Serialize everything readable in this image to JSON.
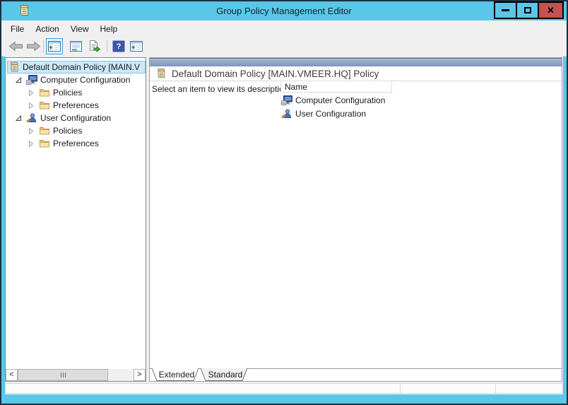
{
  "window": {
    "title": "Group Policy Management Editor",
    "app_icon": "gpo-scroll-icon",
    "controls": [
      "minimize",
      "maximize",
      "close"
    ],
    "close_glyph": "✕"
  },
  "menu_bar": {
    "items": [
      "File",
      "Action",
      "View",
      "Help"
    ]
  },
  "toolbar": {
    "buttons": [
      "back",
      "forward",
      "show-console-tree",
      "properties",
      "export-list",
      "help",
      "show-action-pane"
    ],
    "show_console_tree_active": true,
    "help_glyph": "?"
  },
  "tree": {
    "items": [
      {
        "label": "Default Domain Policy [MAIN.V",
        "icon": "gpo-scroll",
        "level": 0,
        "selected": true,
        "expander": "none"
      },
      {
        "label": "Computer Configuration",
        "icon": "computer",
        "level": 1,
        "selected": false,
        "expander": "expanded"
      },
      {
        "label": "Policies",
        "icon": "folder",
        "level": 2,
        "selected": false,
        "expander": "collapsed"
      },
      {
        "label": "Preferences",
        "icon": "folder",
        "level": 2,
        "selected": false,
        "expander": "collapsed"
      },
      {
        "label": "User Configuration",
        "icon": "user",
        "level": 1,
        "selected": false,
        "expander": "expanded"
      },
      {
        "label": "Policies",
        "icon": "folder",
        "level": 2,
        "selected": false,
        "expander": "collapsed"
      },
      {
        "label": "Preferences",
        "icon": "folder",
        "level": 2,
        "selected": false,
        "expander": "collapsed"
      }
    ],
    "hscrollbar": {
      "left_glyph": "<",
      "right_glyph": ">"
    }
  },
  "main": {
    "header": {
      "title": "Default Domain Policy [MAIN.VMEER.HQ] Policy",
      "icon": "gpo-scroll"
    },
    "description": "Select an item to view its description.",
    "list": {
      "columns": [
        {
          "label": "Name"
        }
      ],
      "rows": [
        {
          "label": "Computer Configuration",
          "icon": "computer"
        },
        {
          "label": "User Configuration",
          "icon": "user"
        }
      ]
    },
    "tabs": [
      {
        "label": "Extended",
        "active": true
      },
      {
        "label": "Standard",
        "active": false
      }
    ]
  },
  "status_bar": {
    "text": ""
  },
  "colors": {
    "frame": "#5ac7e8",
    "close_button": "#c75050",
    "chrome_bg": "#f0f0f0",
    "header_band_top": "#a2b5cf",
    "header_band_bottom": "#8096b9",
    "selection_bg": "#cde8f6",
    "selection_border": "#86c3e6"
  }
}
